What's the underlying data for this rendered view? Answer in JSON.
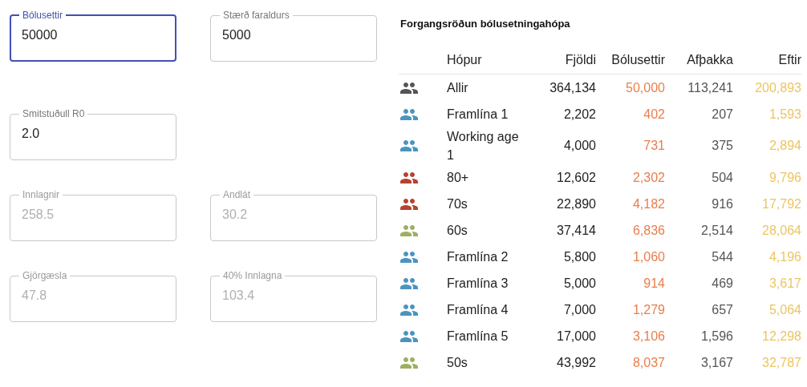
{
  "fields": [
    [
      {
        "label": "Bólusettir",
        "value": "50000",
        "focused": true,
        "disabled": false
      },
      {
        "label": "Stærð faraldurs",
        "value": "5000",
        "focused": false,
        "disabled": false
      }
    ],
    [
      {
        "label": "Smitstuðull R0",
        "value": "2.0",
        "focused": false,
        "disabled": false
      }
    ],
    [
      {
        "label": "Innlagnir",
        "value": "258.5",
        "focused": false,
        "disabled": true
      },
      {
        "label": "Andlát",
        "value": "30.2",
        "focused": false,
        "disabled": true
      }
    ],
    [
      {
        "label": "Gjörgæsla",
        "value": "47.8",
        "focused": false,
        "disabled": true
      },
      {
        "label": "40% Innlagna",
        "value": "103.4",
        "focused": false,
        "disabled": true
      }
    ]
  ],
  "table": {
    "title": "Forgangsröðun bólusetningahópa",
    "columns": [
      "Hópur",
      "Fjöldi",
      "Bólusettir",
      "Afþakka",
      "Eftir"
    ],
    "rows": [
      {
        "color": "#555555",
        "cells": [
          "Allir",
          "364,134",
          "50,000",
          "113,241",
          "200,893"
        ]
      },
      {
        "color": "#4a94c0",
        "cells": [
          "Framlína 1",
          "2,202",
          "402",
          "207",
          "1,593"
        ]
      },
      {
        "color": "#4a94c0",
        "cells": [
          "Working age 1",
          "4,000",
          "731",
          "375",
          "2,894"
        ]
      },
      {
        "color": "#b5432f",
        "cells": [
          "80+",
          "12,602",
          "2,302",
          "504",
          "9,796"
        ]
      },
      {
        "color": "#b5432f",
        "cells": [
          "70s",
          "22,890",
          "4,182",
          "916",
          "17,792"
        ]
      },
      {
        "color": "#9bb060",
        "cells": [
          "60s",
          "37,414",
          "6,836",
          "2,514",
          "28,064"
        ]
      },
      {
        "color": "#4a94c0",
        "cells": [
          "Framlína 2",
          "5,800",
          "1,060",
          "544",
          "4,196"
        ]
      },
      {
        "color": "#4a94c0",
        "cells": [
          "Framlína 3",
          "5,000",
          "914",
          "469",
          "3,617"
        ]
      },
      {
        "color": "#4a94c0",
        "cells": [
          "Framlína 4",
          "7,000",
          "1,279",
          "657",
          "5,064"
        ]
      },
      {
        "color": "#4a94c0",
        "cells": [
          "Framlína 5",
          "17,000",
          "3,106",
          "1,596",
          "12,298"
        ]
      },
      {
        "color": "#9bb060",
        "cells": [
          "50s",
          "43,992",
          "8,037",
          "3,167",
          "32,787"
        ]
      }
    ]
  }
}
